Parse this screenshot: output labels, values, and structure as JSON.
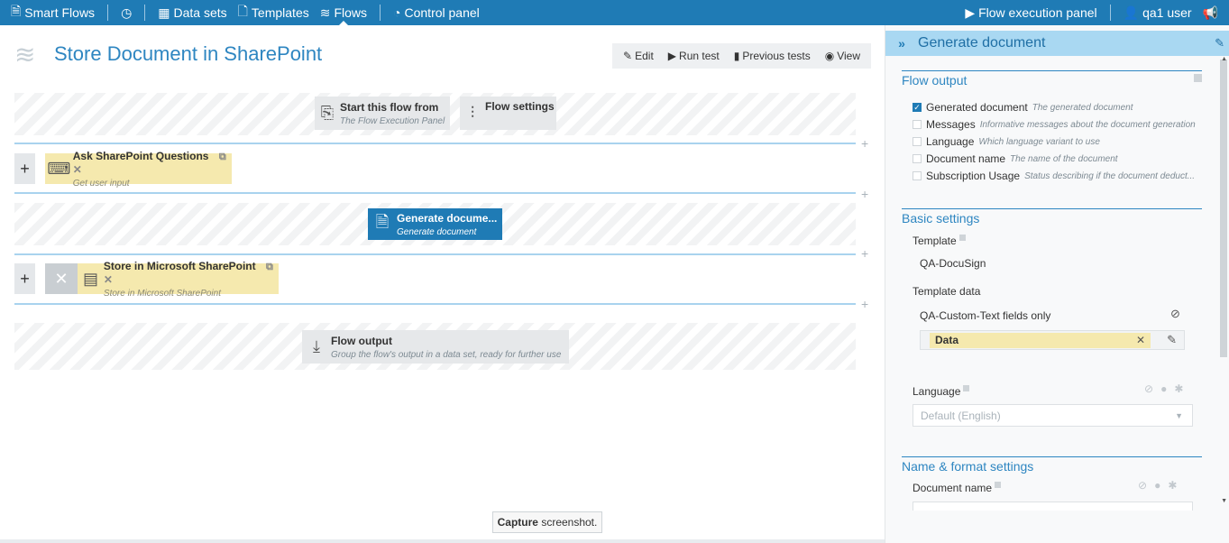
{
  "nav": {
    "app": "Smart Flows",
    "history_icon": "clock-icon",
    "datasets": "Data sets",
    "templates": "Templates",
    "flows": "Flows",
    "control_panel": "Control panel",
    "execution_panel": "Flow execution panel",
    "user": "qa1 user"
  },
  "page": {
    "title": "Store Document in SharePoint",
    "toolbar": {
      "edit": "Edit",
      "run_test": "Run test",
      "previous_tests": "Previous tests",
      "view": "View"
    }
  },
  "flow": {
    "start": {
      "title": "Start this flow from",
      "sub": "The Flow Execution Panel"
    },
    "settings": {
      "title": "Flow settings"
    },
    "step1": {
      "title": "Ask SharePoint Questions",
      "sub": "Get user input"
    },
    "generate": {
      "title": "Generate docume...",
      "sub": "Generate document"
    },
    "step2": {
      "title": "Store in Microsoft SharePoint",
      "sub": "Store in Microsoft SharePoint"
    },
    "output": {
      "title": "Flow output",
      "sub": "Group the flow's output in a data set, ready for further use"
    }
  },
  "tooltip": {
    "bold": "Capture",
    "rest": " screenshot."
  },
  "panel": {
    "title": "Generate document",
    "flow_output": {
      "title": "Flow output",
      "items": [
        {
          "label": "Generated document",
          "desc": "The generated document",
          "checked": true
        },
        {
          "label": "Messages",
          "desc": "Informative messages about the document generation",
          "checked": false
        },
        {
          "label": "Language",
          "desc": "Which language variant to use",
          "checked": false
        },
        {
          "label": "Document name",
          "desc": "The name of the document",
          "checked": false
        },
        {
          "label": "Subscription Usage",
          "desc": "Status describing if the document deduct...",
          "checked": false
        }
      ]
    },
    "basic": {
      "title": "Basic settings",
      "template_label": "Template",
      "template_value": "QA-DocuSign",
      "template_data_label": "Template data",
      "template_data_value": "QA-Custom-Text fields only",
      "data_chip": "Data",
      "language_label": "Language",
      "language_value": "Default (English)"
    },
    "name_format": {
      "title": "Name & format settings",
      "document_name_label": "Document name"
    }
  }
}
